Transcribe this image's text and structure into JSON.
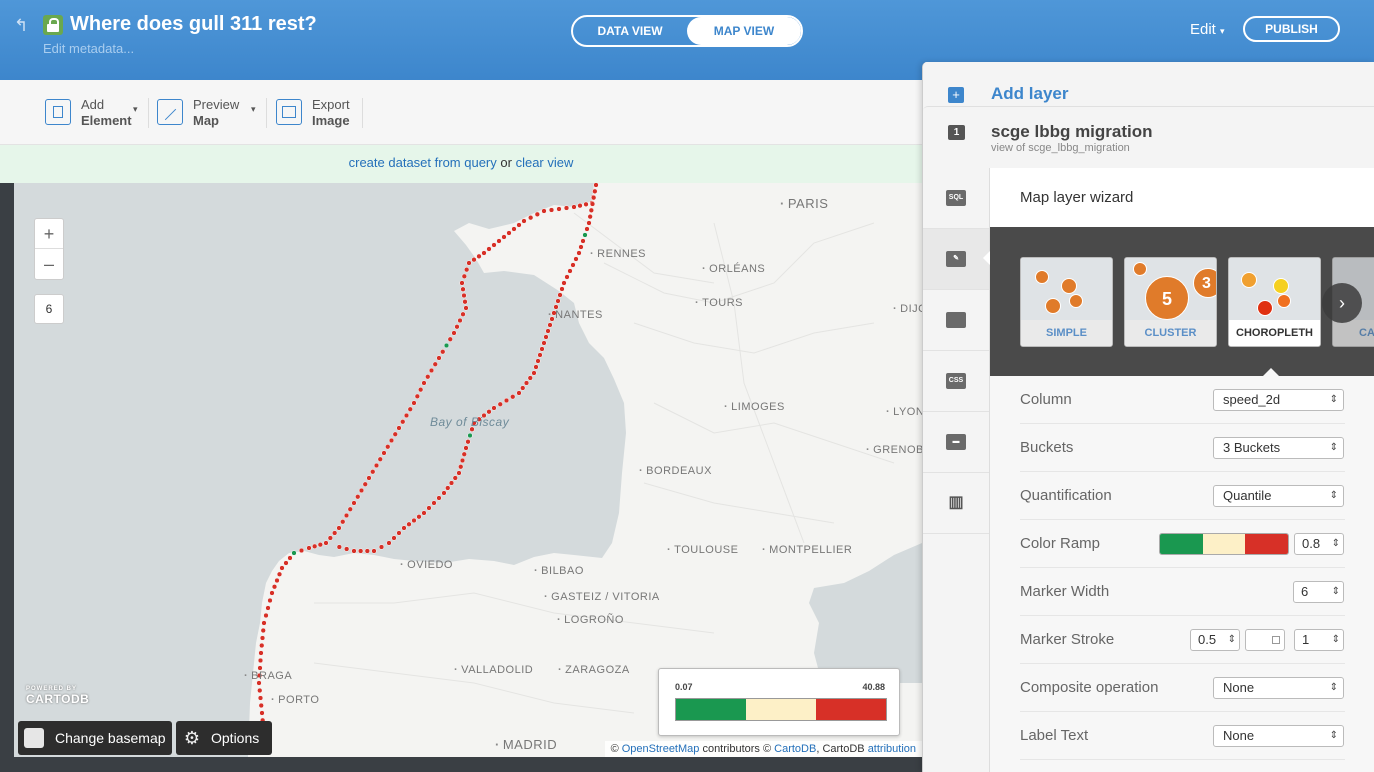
{
  "header": {
    "title": "Where does gull 311 rest?",
    "edit_metadata": "Edit metadata...",
    "tabs": [
      "DATA VIEW",
      "MAP VIEW"
    ],
    "active_tab": "MAP VIEW",
    "edit_menu": "Edit",
    "publish": "PUBLISH"
  },
  "toolbar": {
    "add_element": {
      "line1": "Add",
      "line2": "Element"
    },
    "preview_map": {
      "line1": "Preview",
      "line2": "Map"
    },
    "export_image": {
      "line1": "Export",
      "line2": "Image"
    }
  },
  "query_bar": {
    "create_dataset": "create dataset from query",
    "or": "or",
    "clear_view": "clear view"
  },
  "map": {
    "zoom_in": "+",
    "zoom_out": "–",
    "zoom_level": "6",
    "water_label": "Bay of Biscay",
    "cities": {
      "paris": "PARIS",
      "rennes": "RENNES",
      "orleans": "ORLÉANS",
      "tours": "TOURS",
      "nantes": "NANTES",
      "dijon": "DIJO",
      "limoges": "LIMOGES",
      "lyon": "LYON",
      "grenoble": "GRENOBLE",
      "bordeaux": "BORDEAUX",
      "toulouse": "TOULOUSE",
      "montpellier": "MONTPELLIER",
      "oviedo": "OVIEDO",
      "bilbao": "BILBAO",
      "gasteiz": "GASTEIZ / VITORIA",
      "logrono": "LOGROÑO",
      "valladolid": "VALLADOLID",
      "zaragoza": "ZARAGOZA",
      "braga": "BRAGA",
      "porto": "PORTO",
      "madrid": "MADRID"
    },
    "logo_powered": "POWERED BY",
    "logo_name": "CARTODB",
    "change_basemap": "Change basemap",
    "options": "Options",
    "legend": {
      "min": "0.07",
      "max": "40.88",
      "colors": [
        "#1a9850",
        "#fdf0c7",
        "#d73027"
      ]
    },
    "attribution": {
      "prefix": "© ",
      "osm": "OpenStreetMap",
      "mid": " contributors © ",
      "cartodb": "CartoDB",
      "sep": ", CartoDB ",
      "attr": "attribution"
    },
    "point_colors": {
      "fast": "#d73027",
      "slow": "#1a9850"
    }
  },
  "panel": {
    "add_layer": "Add layer",
    "layer_number": "1",
    "layer_name": "scge lbbg migration",
    "layer_subtitle": "view of scge_lbbg_migration",
    "side_icons": [
      "sql-icon",
      "wizard-icon",
      "infowindow-icon",
      "css-icon",
      "legend-icon",
      "filter-icon"
    ],
    "sql_glyph": "SQL",
    "css_glyph": "CSS",
    "wizard": {
      "title": "Map layer wizard",
      "types": [
        "SIMPLE",
        "CLUSTER",
        "CHOROPLETH",
        "CATE"
      ],
      "selected": "CHOROPLETH",
      "cluster_big": "5",
      "cluster_small": "3",
      "next": "›"
    },
    "properties": {
      "column": {
        "label": "Column",
        "value": "speed_2d"
      },
      "buckets": {
        "label": "Buckets",
        "value": "3 Buckets"
      },
      "quantification": {
        "label": "Quantification",
        "value": "Quantile"
      },
      "color_ramp": {
        "label": "Color Ramp",
        "opacity": "0.8",
        "colors": [
          "#1a9850",
          "#fdf0c7",
          "#d73027"
        ]
      },
      "marker_width": {
        "label": "Marker Width",
        "value": "6"
      },
      "marker_stroke": {
        "label": "Marker Stroke",
        "width": "0.5",
        "opacity": "1"
      },
      "composite": {
        "label": "Composite operation",
        "value": "None"
      },
      "label_text": {
        "label": "Label Text",
        "value": "None"
      }
    }
  }
}
